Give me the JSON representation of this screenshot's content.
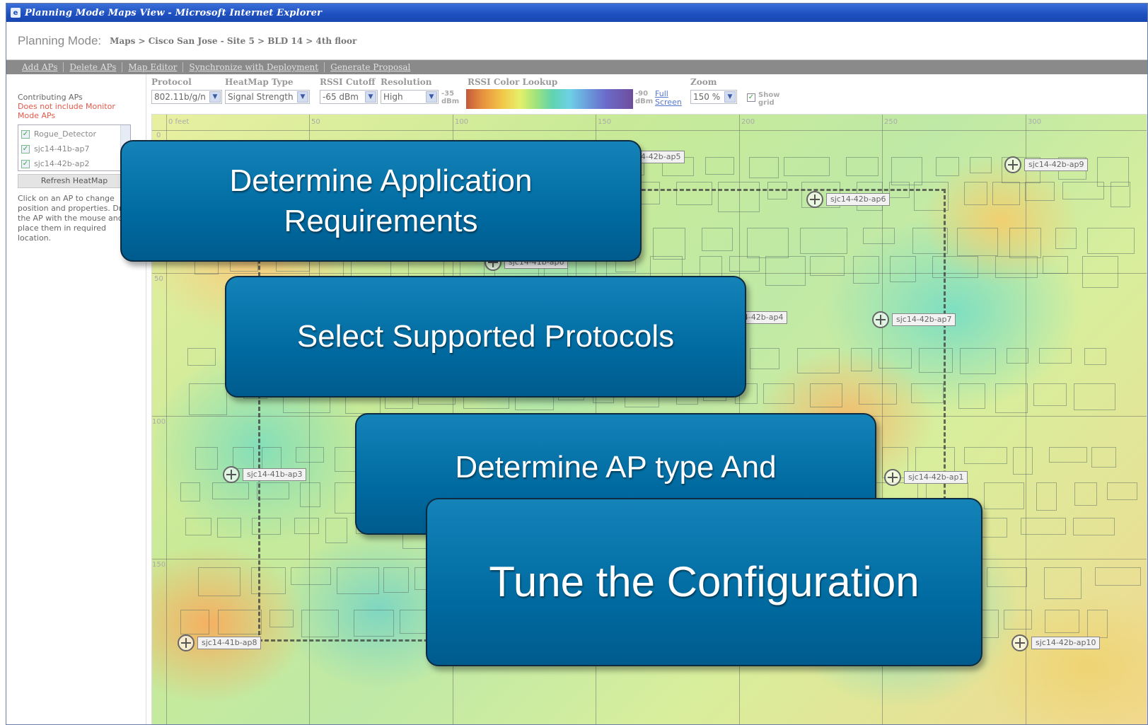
{
  "window": {
    "title": "Planning Mode Maps View - Microsoft Internet Explorer"
  },
  "header": {
    "mode": "Planning Mode:",
    "breadcrumb": "Maps > Cisco San Jose - Site 5 > BLD 14 > 4th floor"
  },
  "actions": [
    "Add APs",
    "Delete APs",
    "Map Editor",
    "Synchronize with Deployment",
    "Generate Proposal"
  ],
  "left": {
    "contributing": "Contributing APs",
    "warning": "Does not include Monitor Mode APs",
    "aps": [
      "Rogue_Detector",
      "sjc14-41b-ap7",
      "sjc14-42b-ap2"
    ],
    "refresh": "Refresh HeatMap",
    "help": "Click on an AP to change position and properties. Drag the AP with the mouse and place them in required location."
  },
  "controls": {
    "protocol_label": "Protocol",
    "protocol_value": "802.11b/g/n",
    "heatmap_label": "HeatMap Type",
    "heatmap_value": "Signal Strength",
    "rssi_label": "RSSI Cutoff",
    "rssi_value": "-65 dBm",
    "resolution_label": "Resolution",
    "resolution_value": "High",
    "rssi_low_value": "-35",
    "rssi_low_unit": "dBm",
    "lookup_label": "RSSI Color Lookup",
    "rssi_high_value": "-90",
    "rssi_high_unit": "dBm",
    "fullscreen_label": "Full Screen",
    "zoom_label": "Zoom",
    "zoom_value": "150 %",
    "showgrid_label": "Show grid"
  },
  "map": {
    "x_ticks": [
      "0 feet",
      "50",
      "100",
      "150",
      "200",
      "250",
      "300"
    ],
    "y_ticks": [
      "0",
      "50",
      "100",
      "150"
    ],
    "aps": [
      {
        "name": "sjc14-42b-ap5"
      },
      {
        "name": "sjc14-42b-ap9"
      },
      {
        "name": "sjc14-42b-ap6"
      },
      {
        "name": "sjc14-41b-ap6"
      },
      {
        "name": "sjc14-42b-ap4"
      },
      {
        "name": "sjc14-42b-ap7"
      },
      {
        "name": "sjc14-41b-ap3"
      },
      {
        "name": "sjc14-42b-ap1"
      },
      {
        "name": "sjc14-41b-ap8"
      },
      {
        "name": "sjc14-42b-ap10"
      }
    ]
  },
  "callouts": {
    "c1": "Determine Application Requirements",
    "c2": "Select Supported Protocols",
    "c3": "Determine AP type And Placement",
    "c4": "Tune the Configuration"
  },
  "colors": {
    "callout": "#006ba1",
    "titlebar": "#1d4fbf"
  }
}
